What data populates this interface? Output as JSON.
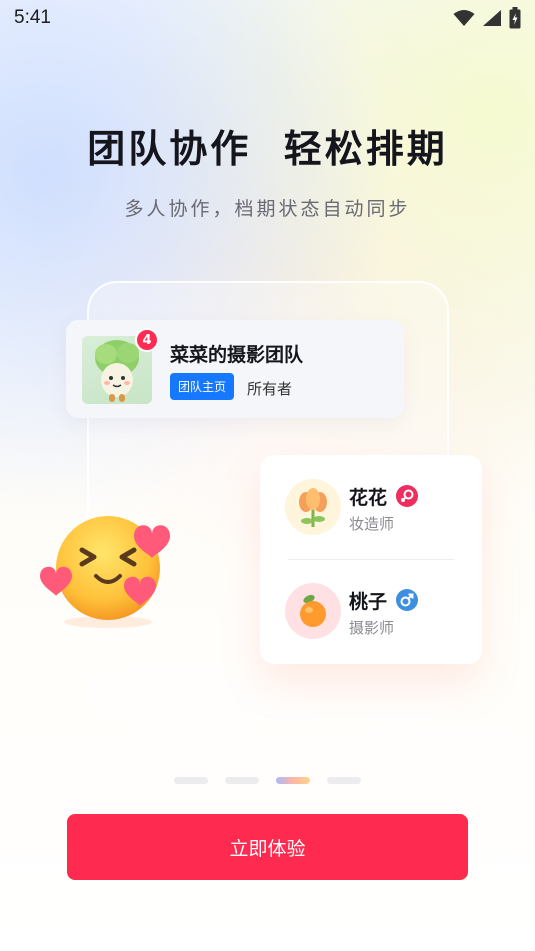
{
  "status_bar": {
    "time": "5:41",
    "icons": [
      "wifi-icon",
      "signal-icon",
      "battery-icon"
    ]
  },
  "headline": "团队协作  轻松排期",
  "subheadline": "多人协作，档期状态自动同步",
  "team_card": {
    "name": "菜菜的摄影团队",
    "badge_count": "4",
    "tag": "团队主页",
    "role": "所有者",
    "avatar_icon": "cabbage-mascot-icon"
  },
  "members": [
    {
      "name": "花花",
      "role": "妆造师",
      "gender": "female",
      "avatar_icon": "flower-icon",
      "gender_color": "#ef2d5e"
    },
    {
      "name": "桃子",
      "role": "摄影师",
      "gender": "male",
      "avatar_icon": "peach-icon",
      "gender_color": "#3f8fe0"
    }
  ],
  "decoration": "smiling-face-with-hearts-emoji",
  "pager": {
    "total": 4,
    "active_index": 2
  },
  "cta": {
    "label": "立即体验",
    "color": "#ff2a4f"
  }
}
